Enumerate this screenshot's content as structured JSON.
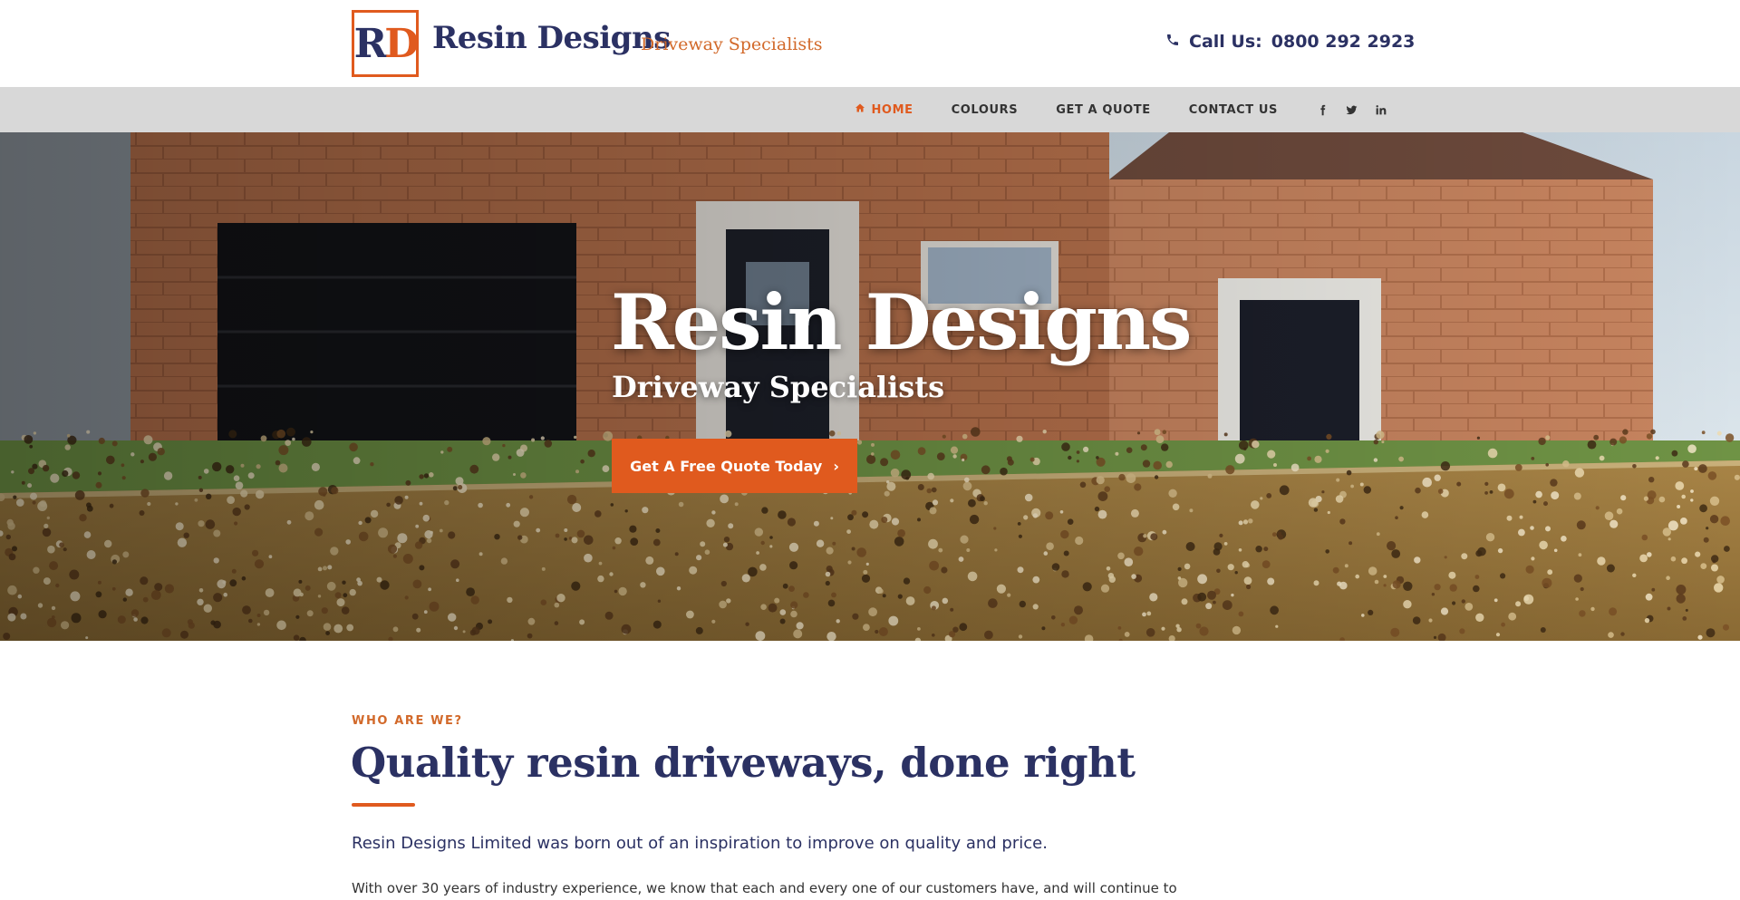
{
  "header": {
    "logo": {
      "letter_1": "R",
      "letter_2": "D"
    },
    "brand_name": "Resin Designs",
    "brand_tagline": "Driveway Specialists",
    "call_label": "Call Us:",
    "phone": "0800 292 2923",
    "icons": {
      "phone": "phone-icon"
    }
  },
  "nav": {
    "items": [
      {
        "label": "HOME",
        "active": true,
        "icon": "home-icon"
      },
      {
        "label": "COLOURS",
        "active": false
      },
      {
        "label": "GET A QUOTE",
        "active": false
      },
      {
        "label": "CONTACT US",
        "active": false
      }
    ],
    "social": [
      {
        "icon": "facebook-icon"
      },
      {
        "icon": "twitter-icon"
      },
      {
        "icon": "linkedin-icon"
      }
    ]
  },
  "hero": {
    "title": "Resin Designs",
    "subtitle": "Driveway Specialists",
    "cta_label": "Get A Free Quote Today",
    "cta_arrow": "›"
  },
  "about": {
    "eyebrow": "WHO ARE WE?",
    "title": "Quality resin driveways, done right",
    "lead": "Resin Designs Limited was born out of an inspiration to improve on quality and price.",
    "body": "With over 30 years of industry experience, we know that each and every one of our customers have, and will continue to"
  },
  "colors": {
    "brand_navy": "#2b3163",
    "brand_orange": "#e05a1e",
    "nav_bar": "#d8d8d8"
  }
}
